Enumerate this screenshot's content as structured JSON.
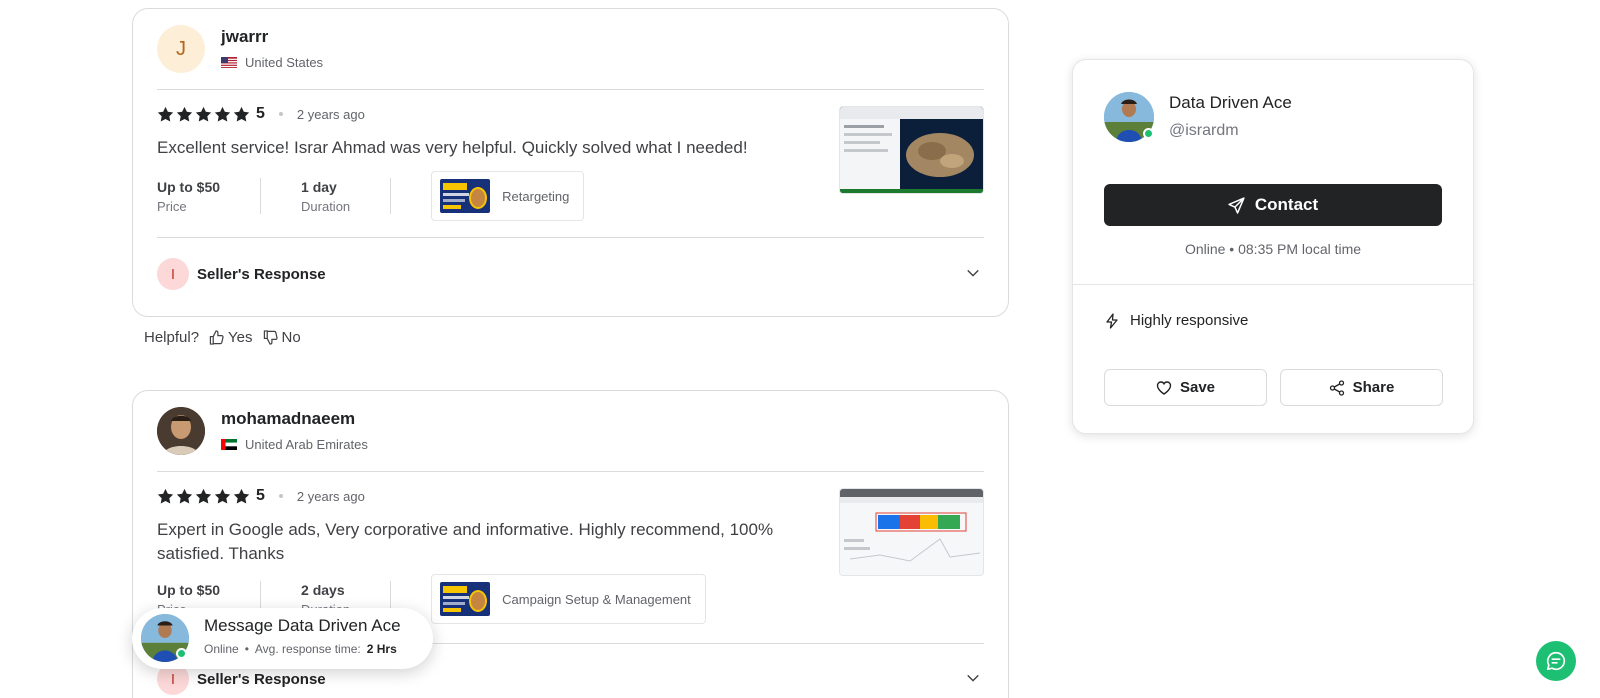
{
  "reviews": [
    {
      "avatar_letter": "J",
      "name": "jwarrr",
      "country": "United States",
      "rating": "5",
      "date": "2 years ago",
      "text": "Excellent service! Israr Ahmad was very helpful. Quickly solved what I needed!",
      "price_value": "Up to $50",
      "price_label": "Price",
      "duration_value": "1 day",
      "duration_label": "Duration",
      "gig_title": "Retargeting",
      "seller_response_letter": "I",
      "seller_response_label": "Seller's Response"
    },
    {
      "name": "mohamadnaeem",
      "country": "United Arab Emirates",
      "rating": "5",
      "date": "2 years ago",
      "text": "Expert in Google ads, Very corporative and informative. Highly recommend, 100% satisfied. Thanks",
      "price_value": "Up to $50",
      "price_label": "Price",
      "duration_value": "2 days",
      "duration_label": "Duration",
      "gig_title": "Campaign Setup & Management",
      "seller_response_letter": "I",
      "seller_response_label": "Seller's Response"
    }
  ],
  "helpful": {
    "label": "Helpful?",
    "yes": "Yes",
    "no": "No"
  },
  "seller": {
    "name": "Data Driven Ace",
    "handle": "@isrardm",
    "contact_label": "Contact",
    "status_line": "Online • 08:35 PM local time",
    "responsive_label": "Highly responsive",
    "save_label": "Save",
    "share_label": "Share"
  },
  "message_bubble": {
    "title": "Message Data Driven Ace",
    "status": "Online",
    "response_label": "Avg. response time:",
    "response_value": "2 Hrs"
  },
  "colors": {
    "brand_green": "#1dbf73",
    "dark_button": "#222325",
    "star": "#222325"
  },
  "icons": [
    "star-icon",
    "thumbs-up-icon",
    "thumbs-down-icon",
    "chevron-down-icon",
    "send-icon",
    "lightning-icon",
    "heart-icon",
    "share-icon",
    "chat-icon"
  ]
}
